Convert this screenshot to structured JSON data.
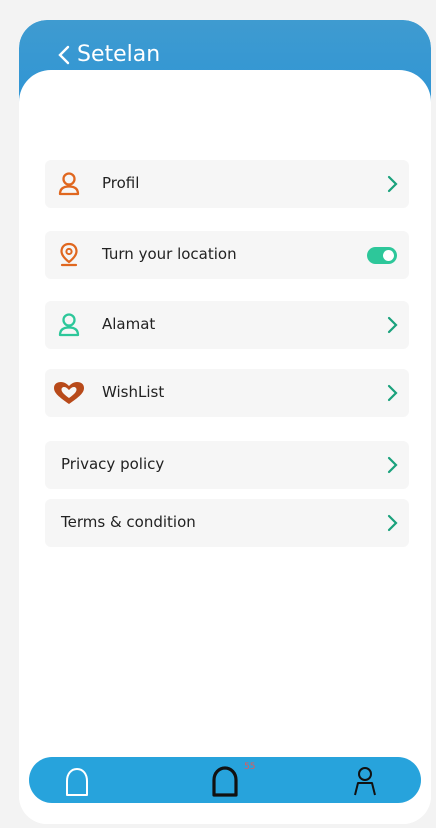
{
  "header": {
    "title": "Setelan"
  },
  "menu": {
    "profile_label": "Profil",
    "location_label": "Turn your location",
    "location_on": true,
    "address_label": "Alamat",
    "wishlist_label": "WishList",
    "privacy_label": "Privacy policy",
    "terms_label": "Terms & condition"
  },
  "nav": {
    "badge_count": "55"
  },
  "colors": {
    "header": "#2a93d6",
    "accent_orange": "#e0671f",
    "accent_green": "#2dc79a",
    "chevron": "#1aa17c",
    "nav": "#27a3dc"
  }
}
